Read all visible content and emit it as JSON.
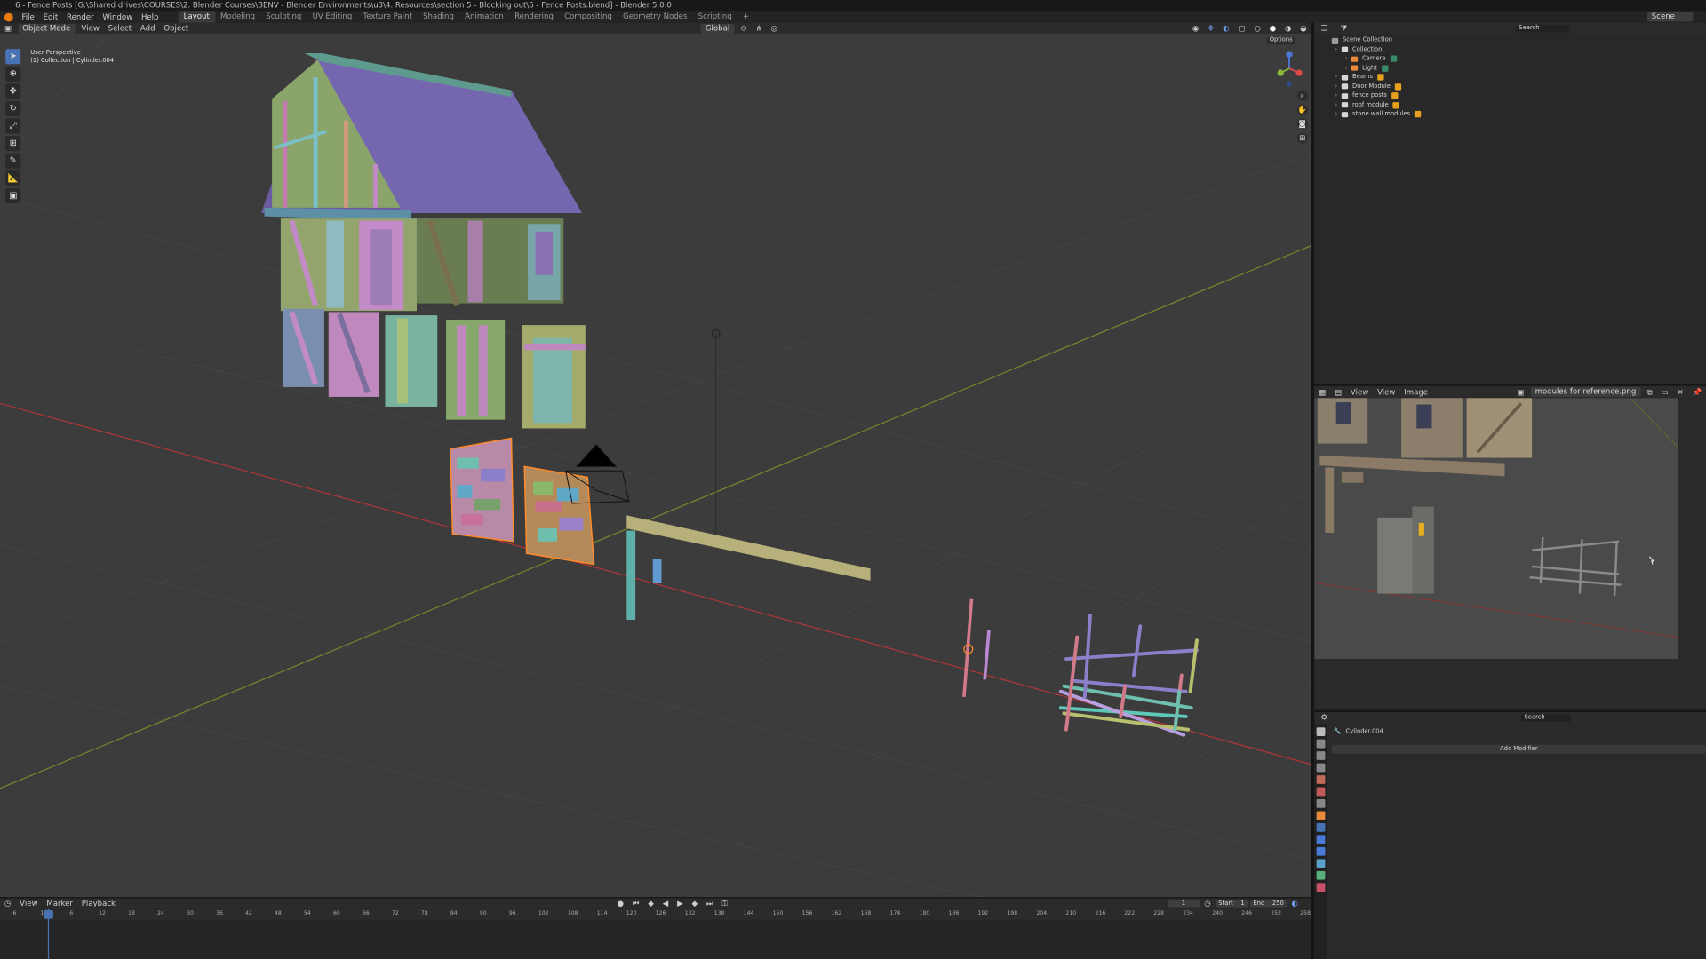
{
  "title_bar": "6 - Fence Posts [G:\\Shared drives\\COURSES\\2. Blender Courses\\BENV - Blender Environments\\u3\\4. Resources\\section 5 - Blocking out\\6 - Fence Posts.blend] - Blender 5.0.0",
  "menus": [
    "File",
    "Edit",
    "Render",
    "Window",
    "Help"
  ],
  "workspaces": [
    "Layout",
    "Modeling",
    "Sculpting",
    "UV Editing",
    "Texture Paint",
    "Shading",
    "Animation",
    "Rendering",
    "Compositing",
    "Geometry Nodes",
    "Scripting"
  ],
  "active_workspace": "Layout",
  "add_workspace": "+",
  "scene_label": "Scene",
  "viewport": {
    "mode": "Object Mode",
    "menus": [
      "View",
      "Select",
      "Add",
      "Object"
    ],
    "transform_orientation": "Global",
    "options_label": "Options",
    "overlay_title": "User Perspective",
    "overlay_sub": "(1) Collection | Cylinder.004",
    "gizmo_axes": [
      "X",
      "Y",
      "Z"
    ]
  },
  "outliner": {
    "search_placeholder": "Search",
    "items": [
      {
        "label": "Scene Collection",
        "depth": 0,
        "color": "#9a9a9a"
      },
      {
        "label": "Collection",
        "depth": 1,
        "color": "#d6d6d6"
      },
      {
        "label": "Camera",
        "depth": 2,
        "color": "#e88a3a"
      },
      {
        "label": "Light",
        "depth": 2,
        "color": "#e88a3a"
      },
      {
        "label": "Beams",
        "depth": 1,
        "color": "#d6d6d6"
      },
      {
        "label": "Door Module",
        "depth": 1,
        "color": "#d6d6d6"
      },
      {
        "label": "fence posts",
        "depth": 1,
        "color": "#d6d6d6"
      },
      {
        "label": "roof module",
        "depth": 1,
        "color": "#d6d6d6"
      },
      {
        "label": "stone wall modules",
        "depth": 1,
        "color": "#d6d6d6"
      }
    ]
  },
  "image_editor": {
    "menus": [
      "View",
      "View",
      "Image"
    ],
    "image_name": "modules for reference.png"
  },
  "properties": {
    "search_placeholder": "Search",
    "object_name": "Cylinder.004",
    "add_modifier": "Add Modifier"
  },
  "timeline": {
    "menus": [
      "View",
      "Marker",
      "Playback"
    ],
    "current_frame": "1",
    "start_label": "Start",
    "start_value": "1",
    "end_label": "End",
    "end_value": "250",
    "ticks": [
      "-6",
      "1",
      "6",
      "12",
      "18",
      "24",
      "30",
      "36",
      "42",
      "48",
      "54",
      "60",
      "66",
      "72",
      "78",
      "84",
      "90",
      "96",
      "102",
      "108",
      "114",
      "120",
      "126",
      "132",
      "138",
      "144",
      "150",
      "156",
      "162",
      "168",
      "174",
      "180",
      "186",
      "192",
      "198",
      "204",
      "210",
      "216",
      "222",
      "228",
      "234",
      "240",
      "246",
      "252",
      "258"
    ]
  },
  "colors": {
    "x_axis": "#b03636",
    "y_axis": "#6e8a2c",
    "select_orange": "#ff8a2a",
    "active_blue": "#4772b3",
    "roof": "#7566b0"
  }
}
